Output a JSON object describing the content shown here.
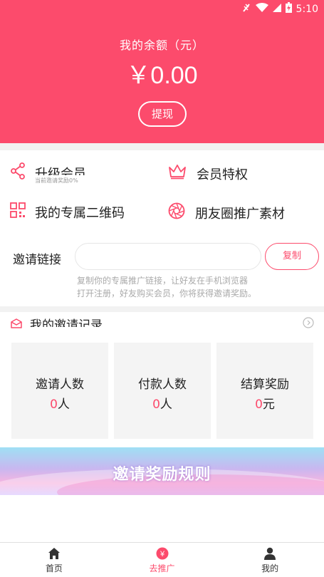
{
  "status_bar": {
    "time": "5:10",
    "icons": [
      "signal-muted-icon",
      "wifi-icon",
      "cell-signal-icon",
      "battery-charging-icon"
    ]
  },
  "balance": {
    "title": "我的余额（元）",
    "amount": "￥0.00",
    "withdraw_label": "提现"
  },
  "menu": {
    "upgrade": {
      "label": "升级会员",
      "sub": "当前邀请奖励0%",
      "icon": "share-icon"
    },
    "privilege": {
      "label": "会员特权",
      "icon": "crown-icon"
    },
    "qrcode": {
      "label": "我的专属二维码",
      "icon": "qrcode-icon"
    },
    "moments": {
      "label": "朋友圈推广素材",
      "icon": "aperture-icon"
    }
  },
  "invite": {
    "label": "邀请链接",
    "link_value": "",
    "copy_label": "复制",
    "hint_line1": "复制你的专属推广链接，让好友在手机浏览器",
    "hint_line2": "打开注册，好友购买会员，你将获得邀请奖励。"
  },
  "records": {
    "title": "我的邀请记录",
    "stats": [
      {
        "label": "邀请人数",
        "value": "0",
        "unit": "人"
      },
      {
        "label": "付款人数",
        "value": "0",
        "unit": "人"
      },
      {
        "label": "结算奖励",
        "value": "0",
        "unit": "元"
      }
    ]
  },
  "banner": {
    "text": "邀请奖励规则"
  },
  "tabbar": {
    "items": [
      {
        "label": "首页",
        "icon": "home-icon"
      },
      {
        "label": "去推广",
        "icon": "yen-coin-icon",
        "active": true
      },
      {
        "label": "我的",
        "icon": "user-icon"
      }
    ]
  },
  "colors": {
    "accent": "#fc4b6c",
    "background_gray": "#f4f4f4"
  }
}
